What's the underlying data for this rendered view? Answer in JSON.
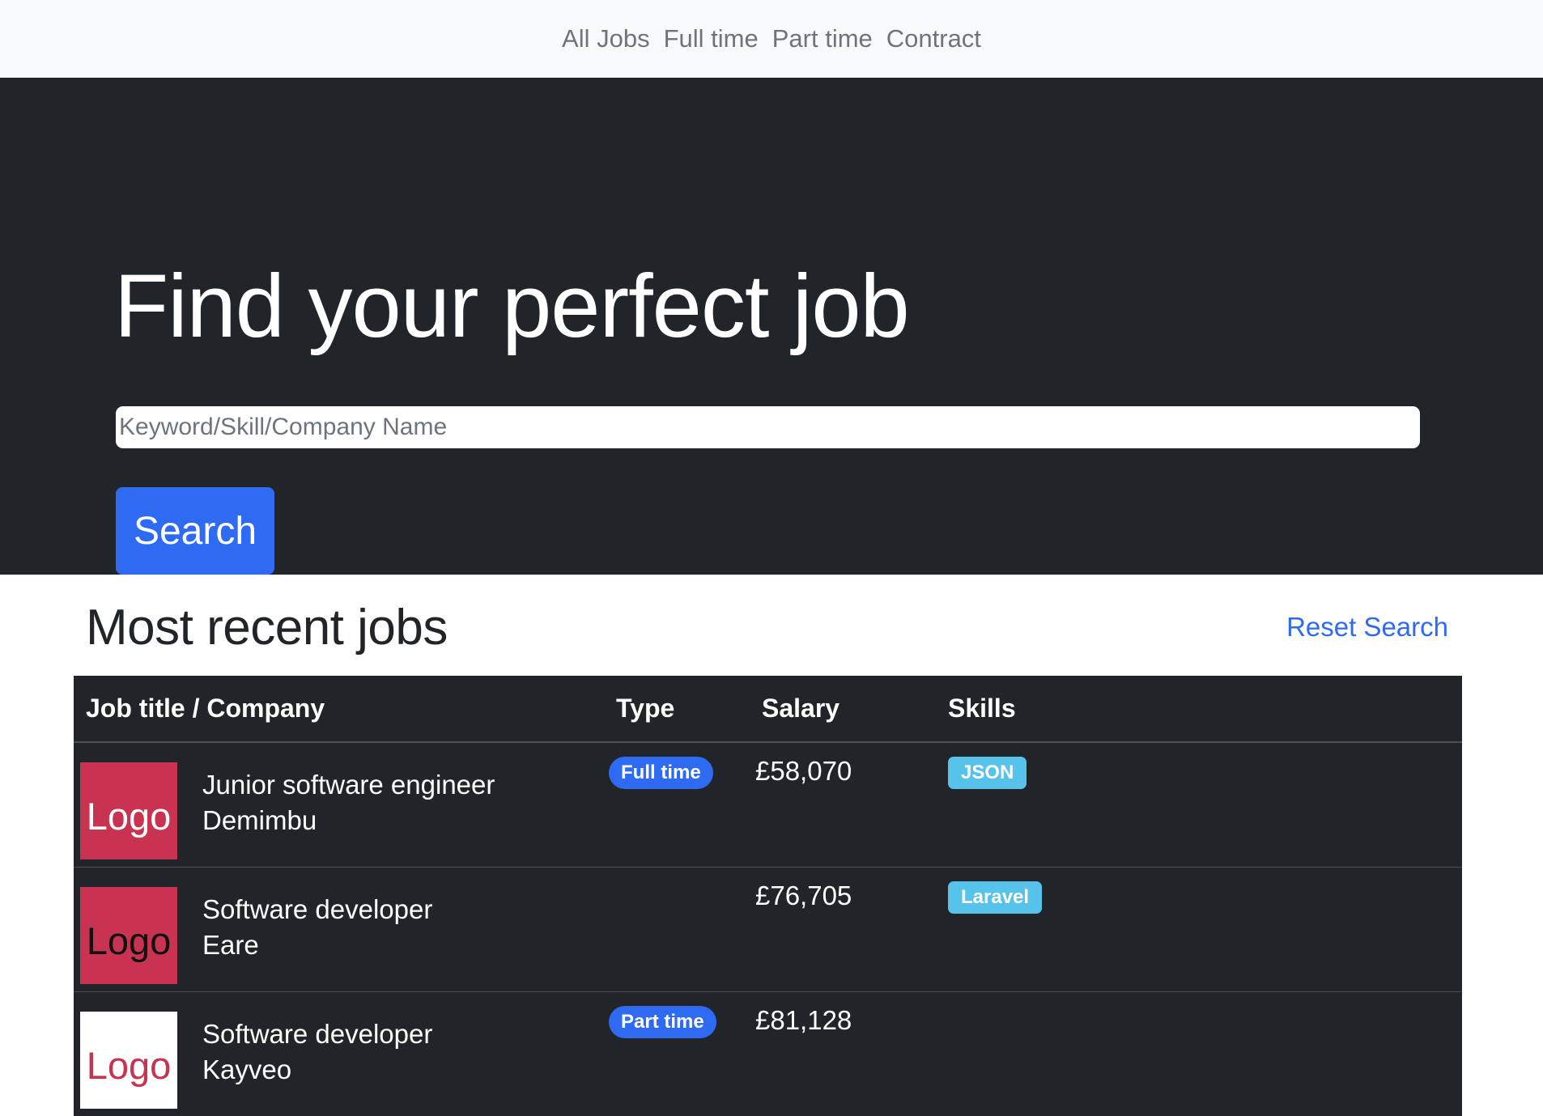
{
  "nav": {
    "links": [
      "All Jobs",
      "Full time",
      "Part time",
      "Contract"
    ]
  },
  "hero": {
    "title": "Find your perfect job",
    "search_placeholder": "Keyword/Skill/Company Name",
    "search_value": "",
    "search_button": "Search"
  },
  "recent": {
    "heading": "Most recent jobs",
    "reset_link": "Reset Search"
  },
  "table": {
    "headers": [
      "Job title / Company",
      "Type",
      "Salary",
      "Skills"
    ],
    "rows": [
      {
        "logo_text": "Logo",
        "logo_bg": "#c73350",
        "logo_color": "#ffffff",
        "title": "Junior software engineer",
        "company": "Demimbu",
        "type": "Full time",
        "salary": "£58,070",
        "skill": "JSON"
      },
      {
        "logo_text": "Logo",
        "logo_bg": "#c73350",
        "logo_color": "#111111",
        "title": "Software developer",
        "company": "Eare",
        "type": "",
        "salary": "£76,705",
        "skill": "Laravel"
      },
      {
        "logo_text": "Logo",
        "logo_bg": "#ffffff",
        "logo_color": "#c73350",
        "title": "Software developer",
        "company": "Kayveo",
        "type": "Part time",
        "salary": "£81,128",
        "skill": ""
      }
    ]
  },
  "colors": {
    "accent": "#2f6bf2",
    "skill_badge": "#57c3ea",
    "dark_bg": "#212529",
    "nav_bg": "#f8f9fa"
  }
}
